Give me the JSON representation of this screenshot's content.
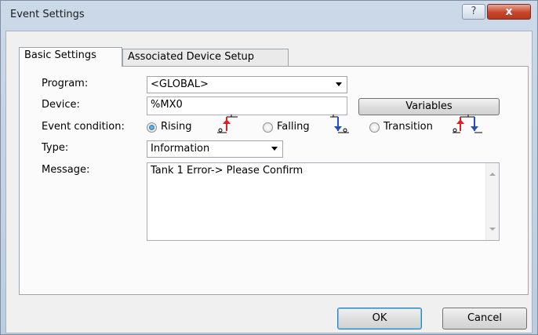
{
  "window": {
    "title": "Event Settings",
    "help": "?",
    "close": "x"
  },
  "tabs": [
    {
      "label": "Basic Settings",
      "active": true
    },
    {
      "label": "Associated Device Setup",
      "active": false
    }
  ],
  "form": {
    "program_label": "Program:",
    "program_value": "<GLOBAL>",
    "device_label": "Device:",
    "device_value": "%MX0",
    "variables_button": "Variables",
    "event_condition_label": "Event condition:",
    "options": [
      {
        "label": "Rising",
        "checked": true,
        "icon": "rising-edge-icon"
      },
      {
        "label": "Falling",
        "checked": false,
        "icon": "falling-edge-icon"
      },
      {
        "label": "Transition",
        "checked": false,
        "icon": "transition-icon"
      }
    ],
    "type_label": "Type:",
    "type_value": "Information",
    "message_label": "Message:",
    "message_value": "Tank 1 Error-> Please Confirm"
  },
  "footer": {
    "ok": "OK",
    "cancel": "Cancel"
  },
  "colors": {
    "rising": "#e02020",
    "falling": "#1f4fd1",
    "close_button": "#c7452c",
    "selected_radio": "#1d5fa0"
  }
}
